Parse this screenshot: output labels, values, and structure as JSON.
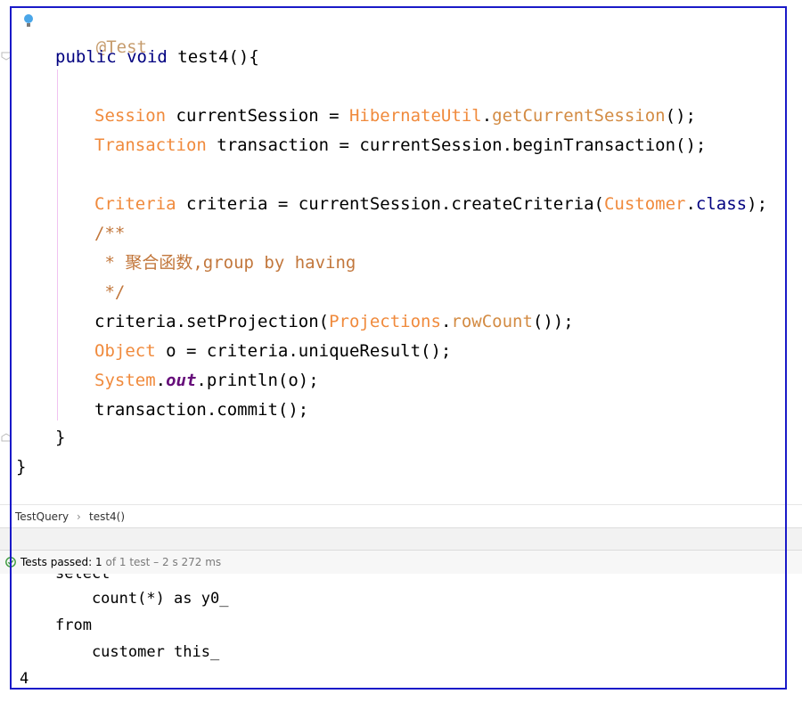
{
  "editor": {
    "annotation": "@Test",
    "sig_kw": "public void",
    "sig_name": " test4(){",
    "l_session_type": "Session",
    "l_session_rest": " currentSession = ",
    "l_session_util": "HibernateUtil",
    "l_session_dot": ".",
    "l_session_method": "getCurrentSession",
    "l_session_end": "();",
    "l_tx_type": "Transaction",
    "l_tx_rest": " transaction = currentSession.beginTransaction();",
    "l_crit_type": "Criteria",
    "l_crit_rest": " criteria = currentSession.createCriteria(",
    "l_crit_class": "Customer",
    "l_crit_dot": ".",
    "l_crit_kw": "class",
    "l_crit_end": ");",
    "comment1": "/**",
    "comment2": " * 聚合函数,group by having",
    "comment3": " */",
    "l_proj_a": "criteria.setProjection(",
    "l_proj_type": "Projections",
    "l_proj_dot": ".",
    "l_proj_method": "rowCount",
    "l_proj_end": "());",
    "l_obj_type": "Object",
    "l_obj_rest": " o = criteria.uniqueResult();",
    "l_sys_type": "System",
    "l_sys_dot": ".",
    "l_sys_out": "out",
    "l_sys_rest": ".println(o);",
    "l_commit": "transaction.commit();",
    "close_method": "}",
    "close_class": "}"
  },
  "breadcrumb": {
    "class_name": "TestQuery",
    "separator": "›",
    "method_name": "test4()"
  },
  "status": {
    "passed_label": "Tests passed: 1",
    "rest": " of 1 test – 2 s 272 ms"
  },
  "console": {
    "line0": "select",
    "line1": "    count(*) as y0_",
    "line2": "from",
    "line3": "    customer this_",
    "line4": "4"
  },
  "colors": {
    "frame": "#1a1ac8",
    "keyword": "#000080",
    "type": "#f08a3c",
    "comment": "#c2773c",
    "pass": "#3c9a3c"
  }
}
